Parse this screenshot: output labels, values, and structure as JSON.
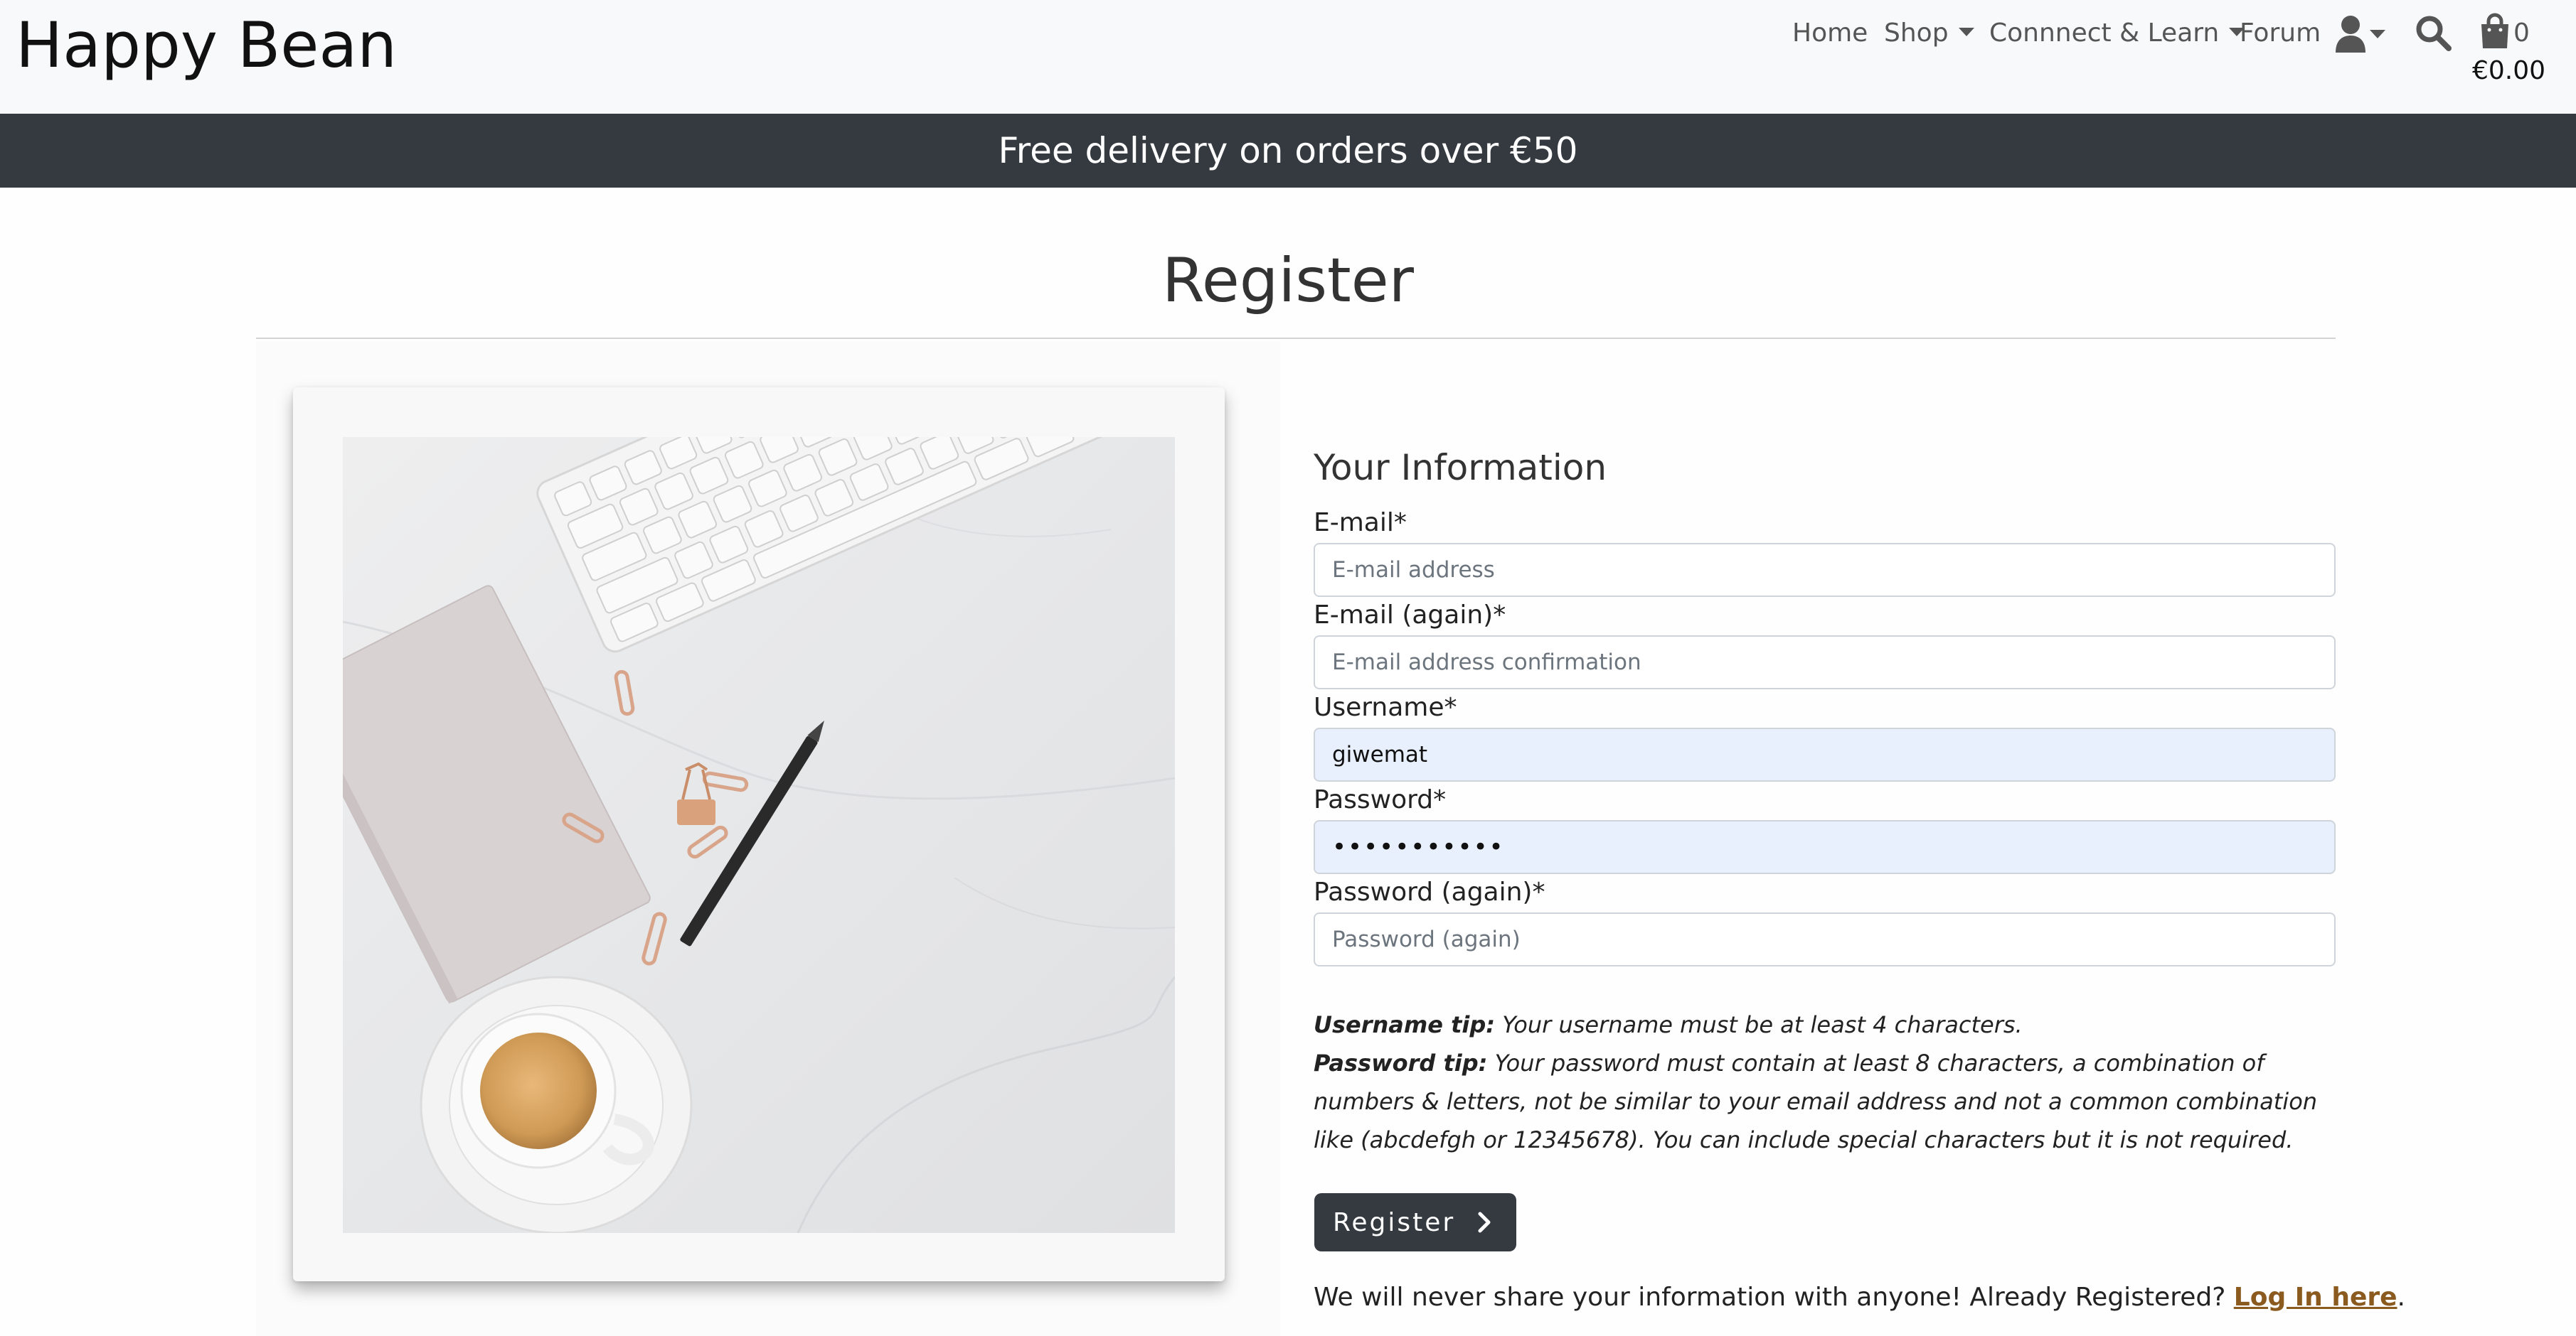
{
  "header": {
    "brand": "Happy Bean",
    "nav": {
      "home": "Home",
      "shop": "Shop",
      "connect_learn": "Connnect & Learn",
      "forum": "Forum"
    },
    "icons": [
      "user-icon",
      "search-icon",
      "shopping-bag-icon"
    ],
    "cart": {
      "count": "0",
      "total": "€0.00"
    }
  },
  "banner": {
    "text": "Free delivery on orders over €50"
  },
  "page": {
    "title": "Register"
  },
  "form": {
    "heading": "Your Information",
    "fields": [
      {
        "label": "E-mail*",
        "value": "",
        "placeholder": "E-mail address"
      },
      {
        "label": "E-mail (again)*",
        "value": "",
        "placeholder": "E-mail address confirmation"
      },
      {
        "label": "Username*",
        "value": "giwemat",
        "placeholder": ""
      },
      {
        "label": "Password*",
        "value": "•••••••••••",
        "placeholder": ""
      },
      {
        "label": "Password (again)*",
        "value": "",
        "placeholder": "Password (again)"
      }
    ],
    "tips": {
      "username_title": "Username tip:",
      "username_text": " Your username must be at least 4 characters.",
      "password_title": "Password tip:",
      "password_text": " Your password must contain at least 8 characters, a combination of numbers & letters, not be similar to your email address and not a common combination like (abcdefgh or 12345678). You can include special characters but it is not required."
    },
    "submit_label": "Register",
    "footer_text": "We will never share your information with anyone! Already Registered? ",
    "login_link": "Log In here",
    "footer_end": "."
  },
  "colors": {
    "nav_bg": "#f8f9fa",
    "banner_bg": "#343a40",
    "button_bg": "#343a40",
    "link": "#8a5a1f",
    "autofill_bg": "#e8f0fe"
  }
}
